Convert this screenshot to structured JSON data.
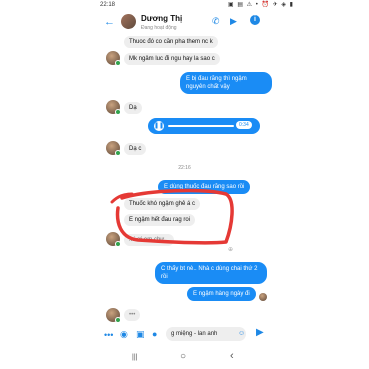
{
  "status_bar": {
    "time": "22:18",
    "icons": "▣ ▤ ⚠ •  ⏰ ✈ ◈ ▮"
  },
  "header": {
    "name": "Dương Thị",
    "subtitle": "Đang hoạt động",
    "back_glyph": "←",
    "call_glyph": "✆",
    "video_glyph": "▶",
    "info_glyph": "i"
  },
  "messages": {
    "in_1": "Thuoc đó  co cần pha them nc k",
    "in_2": "Mk ngâm luc đi ngu hay la sao c",
    "out_1": "E bị đau răng thì ngậm nguyên chất vậy",
    "in_3": "Dạ",
    "voice_duration": "0:34",
    "in_4": "Dạ c",
    "time_divider": "22:16",
    "out_2": "E dùng thuốc đau răng sao rồi",
    "in_5": "Thuốc khó ngậm ghê á c",
    "in_6": "E ngậm hết đau rag roi",
    "in_7_partial": "...i ơi em chư...",
    "out_3": "C thấy bt nè.. Nhà c dùng chai thứ 2 rồi",
    "out_4": "E ngậm hàng ngày đi"
  },
  "composer": {
    "input_value": "g miệng - lan anh",
    "dots_glyph": "•••",
    "camera_glyph": "◉",
    "image_glyph": "▣",
    "mic_glyph": "●",
    "emoji_glyph": "☺",
    "like_glyph": "▶"
  },
  "nav": {
    "recent": "|||",
    "home": "○",
    "back": "‹"
  },
  "colors": {
    "accent": "#1a8cf5",
    "annotation": "#e53935"
  }
}
